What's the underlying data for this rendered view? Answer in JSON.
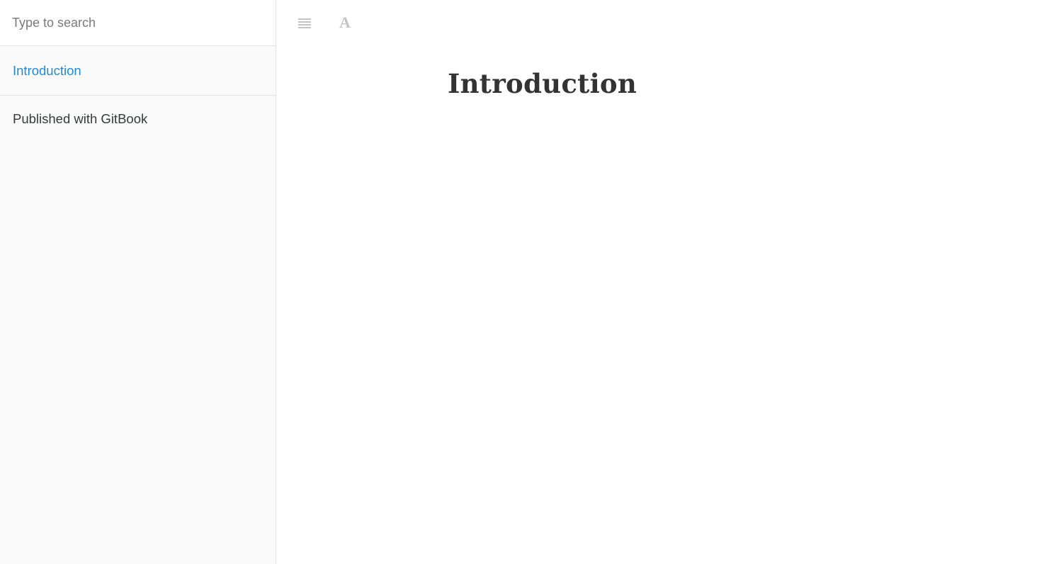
{
  "sidebar": {
    "search": {
      "placeholder": "Type to search",
      "value": ""
    },
    "items": [
      {
        "label": "Introduction",
        "active": true
      }
    ],
    "footer_label": "Published with GitBook"
  },
  "header": {
    "buttons": [
      {
        "icon": "hamburger-menu-icon"
      },
      {
        "icon": "font-settings-icon",
        "glyph": "A"
      }
    ]
  },
  "page": {
    "title": "Introduction"
  },
  "colors": {
    "link_active": "#1e8ad6",
    "text": "#333333",
    "sidebar_bg": "#fafafa",
    "icon_muted": "#c4c4c4"
  }
}
